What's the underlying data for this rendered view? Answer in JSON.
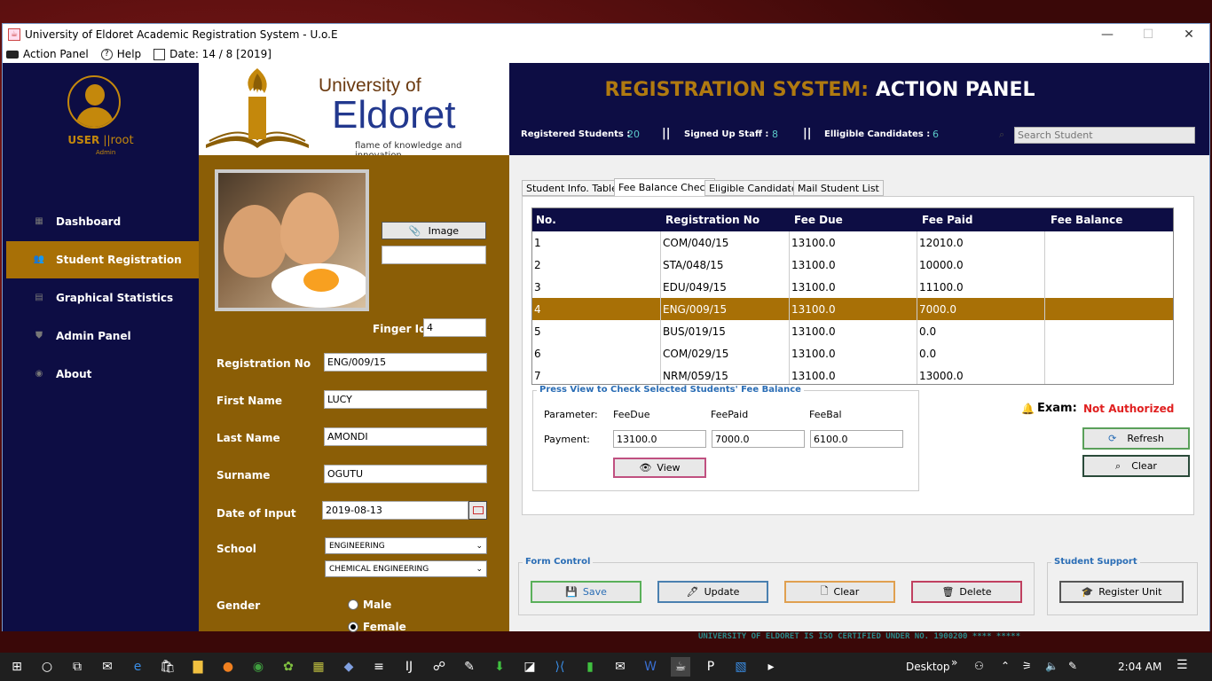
{
  "window": {
    "title": "University of Eldoret Academic Registration System - U.o.E",
    "menu": {
      "action_panel": "Action Panel",
      "help": "Help",
      "date": "Date: 14 / 8  [2019]"
    }
  },
  "sidebar": {
    "user": "USER",
    "user_sep": "||",
    "user_name": "root",
    "role": "Admin",
    "items": [
      {
        "label": "Dashboard",
        "icon": "dashboard-icon"
      },
      {
        "label": "Student Registration",
        "icon": "users-icon"
      },
      {
        "label": "Graphical Statistics",
        "icon": "chart-icon"
      },
      {
        "label": "Admin Panel",
        "icon": "shield-icon"
      },
      {
        "label": "About",
        "icon": "info-icon"
      }
    ]
  },
  "logo": {
    "line1": "University of",
    "line2": "Eldoret",
    "tagline": "flame of knowledge and innovation"
  },
  "header": {
    "title_accent": "REGISTRATION SYSTEM:",
    "title_rest": "ACTION PANEL",
    "stats": {
      "registered_label": "Registered Students :",
      "registered_value": "20",
      "sep": "||",
      "staff_label": "Signed Up Staff :",
      "staff_value": "8",
      "eligible_label": "Elligible Candidates :",
      "eligible_value": "6"
    },
    "search_placeholder": "Search Student"
  },
  "form": {
    "image_button": "Image",
    "image_path": "",
    "finger_label": "Finger Id:",
    "finger_value": "4",
    "reg_label": "Registration No",
    "reg_value": "ENG/009/15",
    "first_label": "First Name",
    "first_value": "LUCY",
    "last_label": "Last Name",
    "last_value": "AMONDI",
    "surname_label": "Surname",
    "surname_value": "OGUTU",
    "date_label": "Date of Input",
    "date_value": "2019-08-13",
    "school_label": "School",
    "school_value": "ENGINEERING",
    "dept_value": "CHEMICAL ENGINEERING",
    "gender_label": "Gender",
    "male": "Male",
    "female": "Female",
    "gender_selected": "Female"
  },
  "tabs": [
    "Student Info. Table",
    "Fee Balance Check",
    "Eligible Candidates",
    "Mail Student List"
  ],
  "table": {
    "columns": [
      "No.",
      "Registration No",
      "Fee Due",
      "Fee Paid",
      "Fee Balance"
    ],
    "rows": [
      [
        "1",
        "COM/040/15",
        "13100.0",
        "12010.0",
        ""
      ],
      [
        "2",
        "STA/048/15",
        "13100.0",
        "10000.0",
        ""
      ],
      [
        "3",
        "EDU/049/15",
        "13100.0",
        "11100.0",
        ""
      ],
      [
        "4",
        "ENG/009/15",
        "13100.0",
        "7000.0",
        ""
      ],
      [
        "5",
        "BUS/019/15",
        "13100.0",
        "0.0",
        ""
      ],
      [
        "6",
        "COM/029/15",
        "13100.0",
        "0.0",
        ""
      ],
      [
        "7",
        "NRM/059/15",
        "13100.0",
        "13000.0",
        ""
      ]
    ],
    "selected_row": 4
  },
  "fee": {
    "legend": "Press View to Check Selected Students' Fee Balance",
    "param_label": "Parameter:",
    "pay_label": "Payment:",
    "col1": "FeeDue",
    "col2": "FeePaid",
    "col3": "FeeBal",
    "due": "13100.0",
    "paid": "7000.0",
    "bal": "6100.0",
    "view": "View"
  },
  "exam": {
    "label": "Exam:",
    "status": "Not Authorized",
    "refresh": "Refresh",
    "clear": "Clear"
  },
  "form_control": {
    "legend": "Form Control",
    "save": "Save",
    "update": "Update",
    "clear": "Clear",
    "delete": "Delete"
  },
  "support": {
    "legend": "Student Support",
    "register": "Register Unit"
  },
  "footer": "UNIVERSITY OF ELDORET IS ISO CERTIFIED UNDER NO. 1900200 **** *****",
  "taskbar": {
    "desktop": "Desktop",
    "time": "2:04 AM"
  },
  "colors": {
    "navy": "#0d0d44",
    "gold": "#a87006",
    "brown": "#8b5e06",
    "red": "#e02020"
  }
}
